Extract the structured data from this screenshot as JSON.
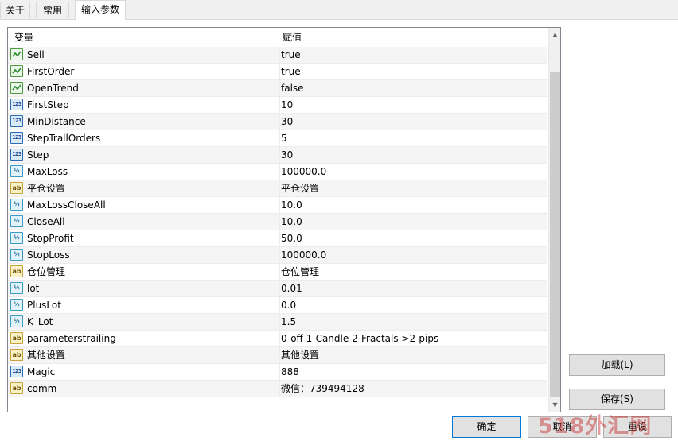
{
  "tabs": [
    {
      "label": "关于"
    },
    {
      "label": "常用"
    },
    {
      "label": "输入参数"
    }
  ],
  "grid": {
    "columns": {
      "variable": "变量",
      "value": "赋值"
    },
    "rows": [
      {
        "icon": "bool-icon",
        "name": "Sell",
        "value": "true"
      },
      {
        "icon": "bool-icon",
        "name": "FirstOrder",
        "value": "true"
      },
      {
        "icon": "bool-icon",
        "name": "OpenTrend",
        "value": "false"
      },
      {
        "icon": "int-icon",
        "name": "FirstStep",
        "value": "10"
      },
      {
        "icon": "int-icon",
        "name": "MinDistance",
        "value": "30"
      },
      {
        "icon": "int-icon",
        "name": "StepTrallOrders",
        "value": "5"
      },
      {
        "icon": "int-icon",
        "name": "Step",
        "value": "30"
      },
      {
        "icon": "double-icon",
        "name": "MaxLoss",
        "value": "100000.0"
      },
      {
        "icon": "string-icon",
        "name": "平仓设置",
        "value": "平仓设置"
      },
      {
        "icon": "double-icon",
        "name": "MaxLossCloseAll",
        "value": "10.0"
      },
      {
        "icon": "double-icon",
        "name": "CloseAll",
        "value": "10.0"
      },
      {
        "icon": "double-icon",
        "name": "StopProfit",
        "value": "50.0"
      },
      {
        "icon": "double-icon",
        "name": "StopLoss",
        "value": "100000.0"
      },
      {
        "icon": "string-icon",
        "name": "仓位管理",
        "value": "仓位管理"
      },
      {
        "icon": "double-icon",
        "name": "lot",
        "value": "0.01"
      },
      {
        "icon": "double-icon",
        "name": "PlusLot",
        "value": "0.0"
      },
      {
        "icon": "double-icon",
        "name": "K_Lot",
        "value": "1.5"
      },
      {
        "icon": "string-icon",
        "name": "parameterstrailing",
        "value": "0-off  1-Candle  2-Fractals  >2-pips"
      },
      {
        "icon": "string-icon",
        "name": "其他设置",
        "value": "其他设置"
      },
      {
        "icon": "int-icon",
        "name": "Magic",
        "value": "888"
      },
      {
        "icon": "string-icon",
        "name": "comm",
        "value": "微信：739494128"
      }
    ]
  },
  "icon_glyphs": {
    "int": "123",
    "double": "½",
    "string": "ab"
  },
  "buttons": {
    "load": "加载(L)",
    "save": "保存(S)",
    "ok": "确定",
    "cancel": "取消",
    "reset": "重设"
  },
  "watermark": "518外汇网",
  "colors": {
    "tab_active_bg": "#ffffff",
    "primary_border": "#0078d7",
    "grid_border": "#828790"
  }
}
